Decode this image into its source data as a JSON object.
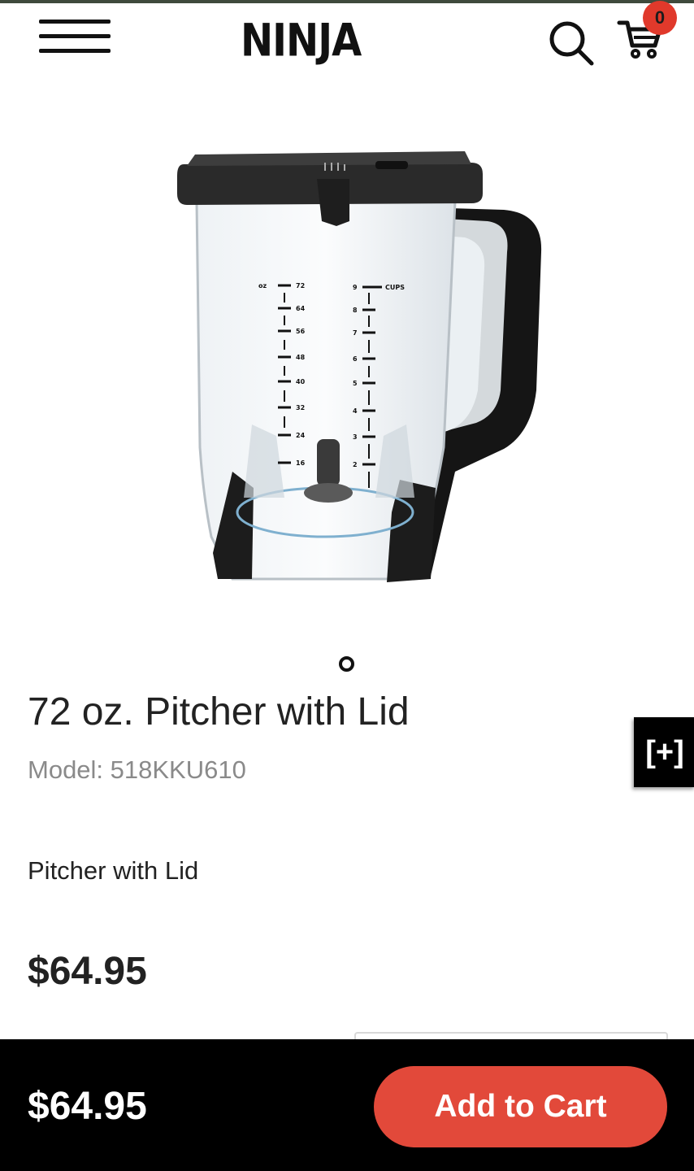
{
  "header": {
    "brand": "NINJA",
    "cart_count": "0",
    "icons": {
      "menu": "hamburger-icon",
      "search": "search-icon",
      "cart": "cart-icon"
    }
  },
  "product": {
    "title": "72 oz. Pitcher with Lid",
    "model": "Model: 518KKU610",
    "description": "Pitcher with Lid",
    "price": "$64.95",
    "image_markings": {
      "oz_unit": "oz",
      "cups_unit": "CUPS",
      "oz_marks": [
        "72",
        "64",
        "56",
        "48",
        "40",
        "32",
        "24",
        "16"
      ],
      "cup_marks": [
        "9",
        "8",
        "7",
        "6",
        "5",
        "4",
        "3",
        "2"
      ]
    }
  },
  "side_tab": {
    "label": "[+]"
  },
  "bottom_bar": {
    "price": "$64.95",
    "cta_label": "Add to Cart"
  },
  "colors": {
    "accent": "#e2493a",
    "badge": "#e0392b",
    "top_strip": "#3f4a3c"
  }
}
